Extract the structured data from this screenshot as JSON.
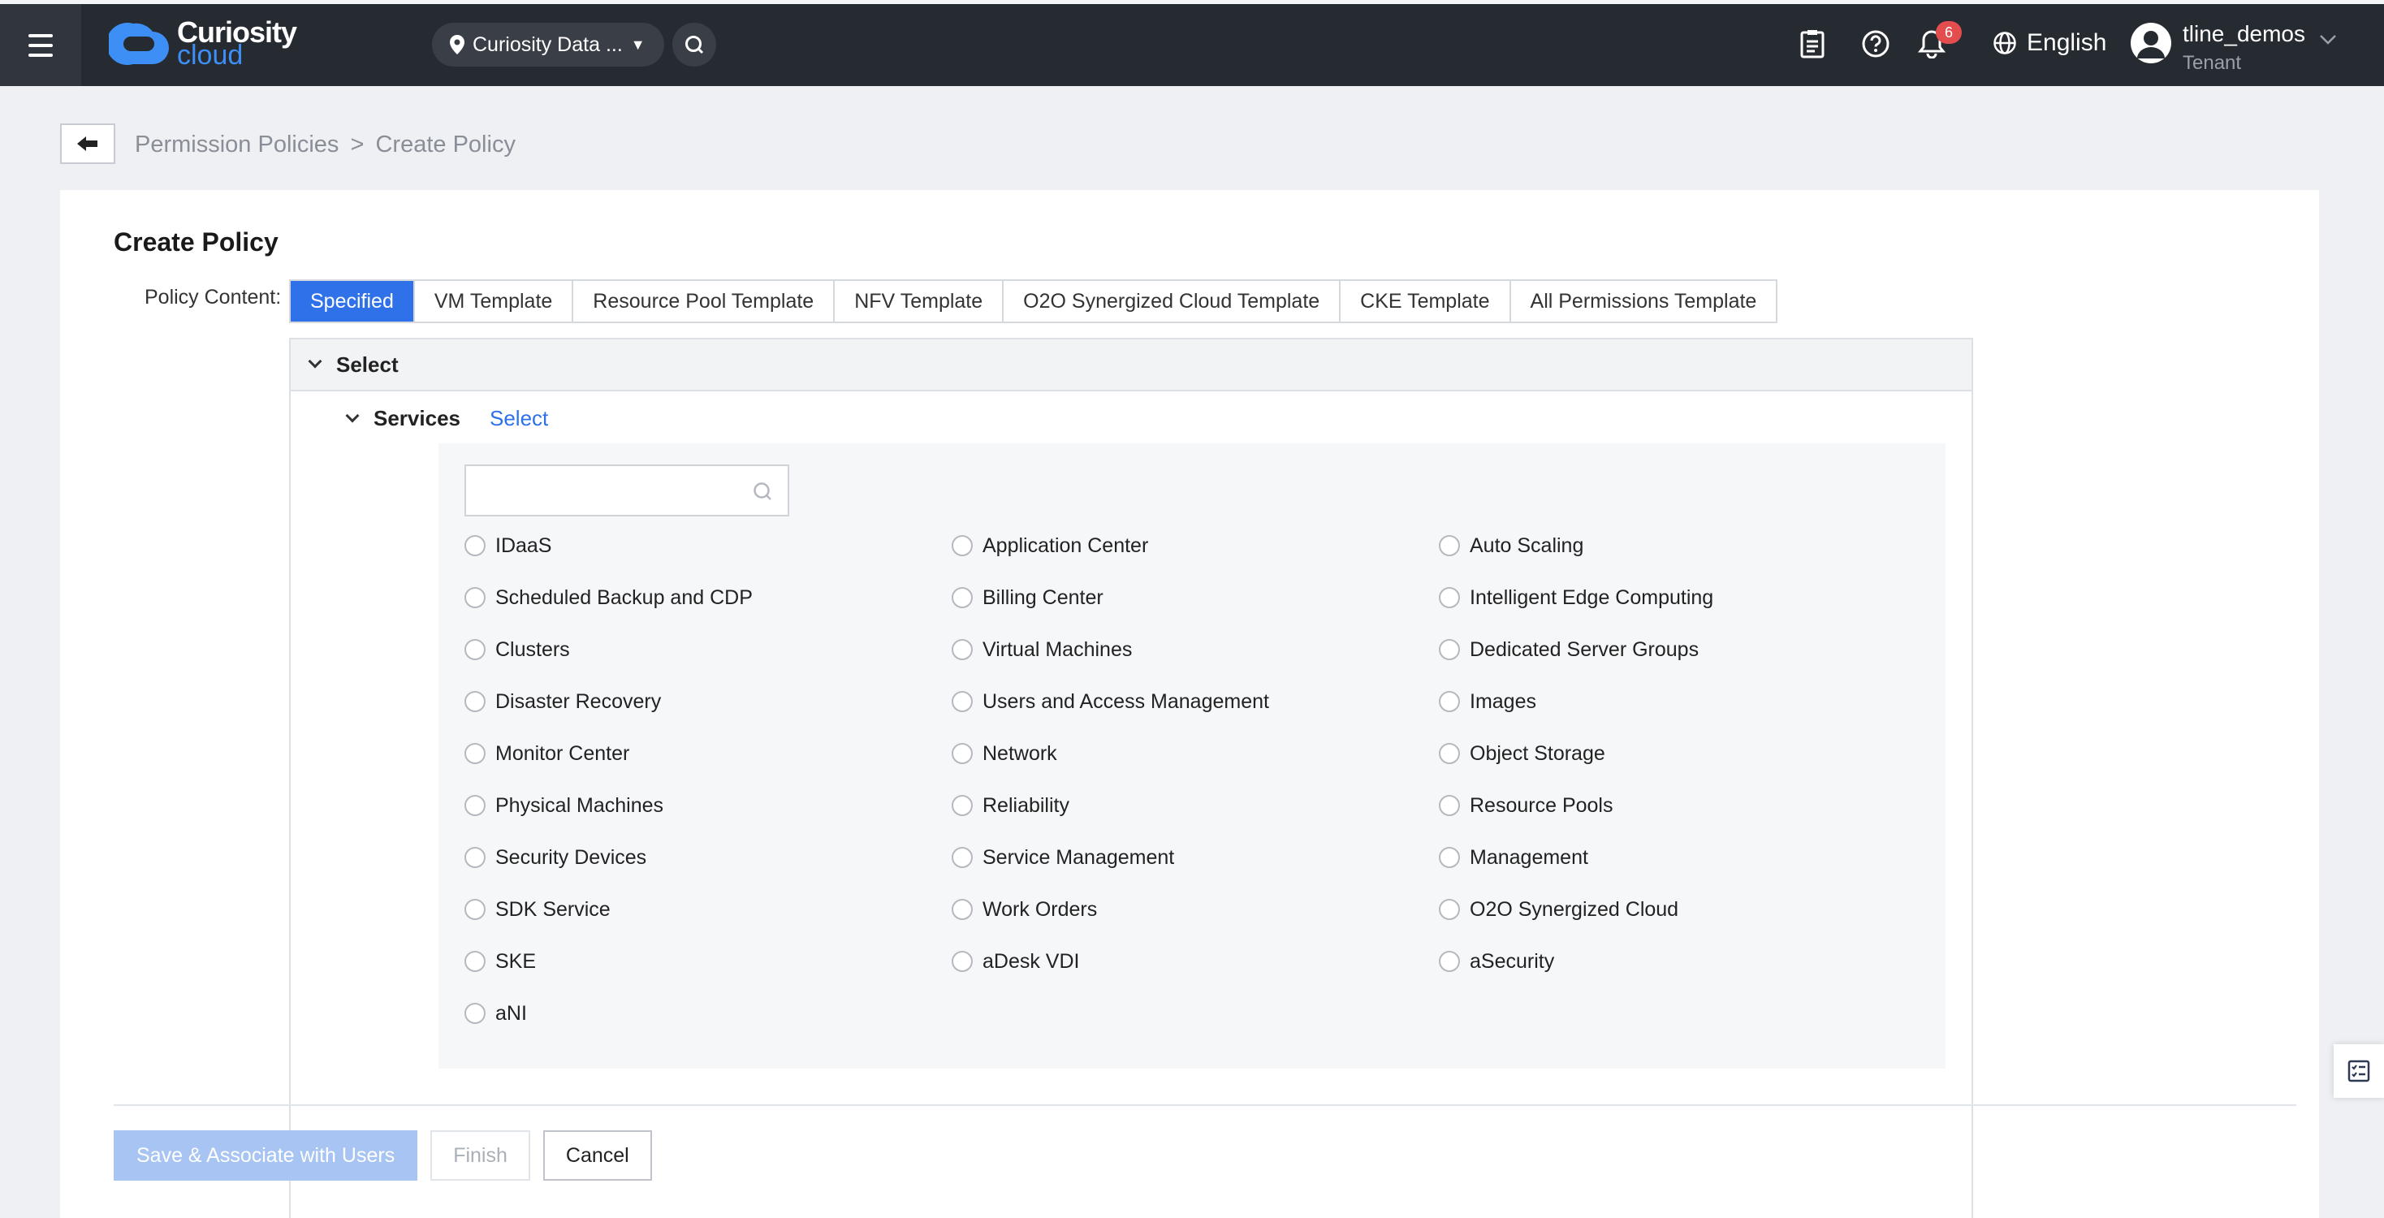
{
  "app": {
    "logo_top": "Curiosity",
    "logo_bottom": "cloud"
  },
  "header": {
    "region": "Curiosity Data ...",
    "notifications_count": "6",
    "language": "English",
    "user_name": "tline_demos",
    "user_role": "Tenant",
    "icons": [
      "menu-icon",
      "location-pin-icon",
      "search-icon",
      "clipboard-icon",
      "help-icon",
      "bell-icon",
      "globe-icon",
      "user-avatar-icon",
      "chevron-down-icon"
    ]
  },
  "breadcrumb": {
    "parent": "Permission Policies",
    "separator": ">",
    "current": "Create Policy"
  },
  "page": {
    "title": "Create Policy",
    "policy_content_label": "Policy Content:",
    "tabs": [
      "Specified",
      "VM Template",
      "Resource Pool Template",
      "NFV Template",
      "O2O Synergized Cloud Template",
      "CKE Template",
      "All Permissions Template"
    ],
    "active_tab": "Specified",
    "select_section": "Select",
    "services_label": "Services",
    "services_select_link": "Select",
    "search_placeholder": "",
    "services": [
      "IDaaS",
      "Application Center",
      "Auto Scaling",
      "Scheduled Backup and CDP",
      "Billing Center",
      "Intelligent Edge Computing",
      "Clusters",
      "Virtual Machines",
      "Dedicated Server Groups",
      "Disaster Recovery",
      "Users and Access Management",
      "Images",
      "Monitor Center",
      "Network",
      "Object Storage",
      "Physical Machines",
      "Reliability",
      "Resource Pools",
      "Security Devices",
      "Service Management",
      "Management",
      "SDK Service",
      "Work Orders",
      "O2O Synergized Cloud",
      "SKE",
      "aDesk VDI",
      "aSecurity",
      "aNI"
    ]
  },
  "actions": {
    "save_associate": "Save & Associate with Users",
    "finish": "Finish",
    "cancel": "Cancel"
  },
  "colors": {
    "accent": "#2e71e8",
    "topbar": "#262a31",
    "badge": "#e34d4d"
  }
}
